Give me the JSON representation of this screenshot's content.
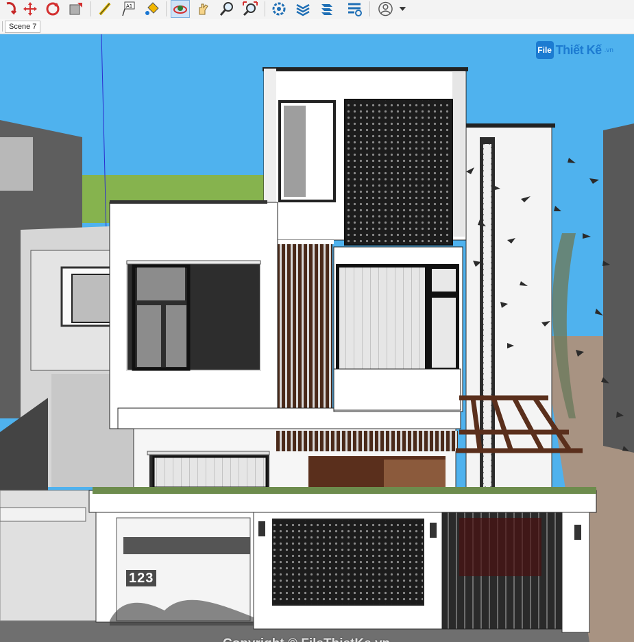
{
  "toolbar": {
    "tools": [
      {
        "name": "orbit-icon"
      },
      {
        "name": "move-icon"
      },
      {
        "name": "rotate-icon"
      },
      {
        "name": "scale-icon"
      },
      {
        "name": "tape-measure-icon"
      },
      {
        "name": "text-icon"
      },
      {
        "name": "paint-bucket-icon"
      },
      {
        "name": "orbit-view-icon"
      },
      {
        "name": "pan-icon"
      },
      {
        "name": "zoom-icon"
      },
      {
        "name": "zoom-extents-icon"
      },
      {
        "name": "component-settings-icon"
      },
      {
        "name": "layers-icon"
      },
      {
        "name": "extension-icon"
      },
      {
        "name": "settings-gear-icon"
      },
      {
        "name": "account-icon"
      }
    ],
    "text_tool_badge": "A1"
  },
  "scene_bar": {
    "active_scene": "Scene 7"
  },
  "viewport": {
    "logo": {
      "mark": "File",
      "text": "Thiết Kế",
      "suffix": ".vn"
    },
    "house_number": "123",
    "watermark": "Copyright © FileThietKe.vn"
  },
  "colors": {
    "sky": "#4fb2ee",
    "wall": "#ffffff",
    "dark": "#2f2f2f",
    "wood": "#6b3a24",
    "grass": "#86b34e",
    "logo": "#1c7bd1"
  }
}
